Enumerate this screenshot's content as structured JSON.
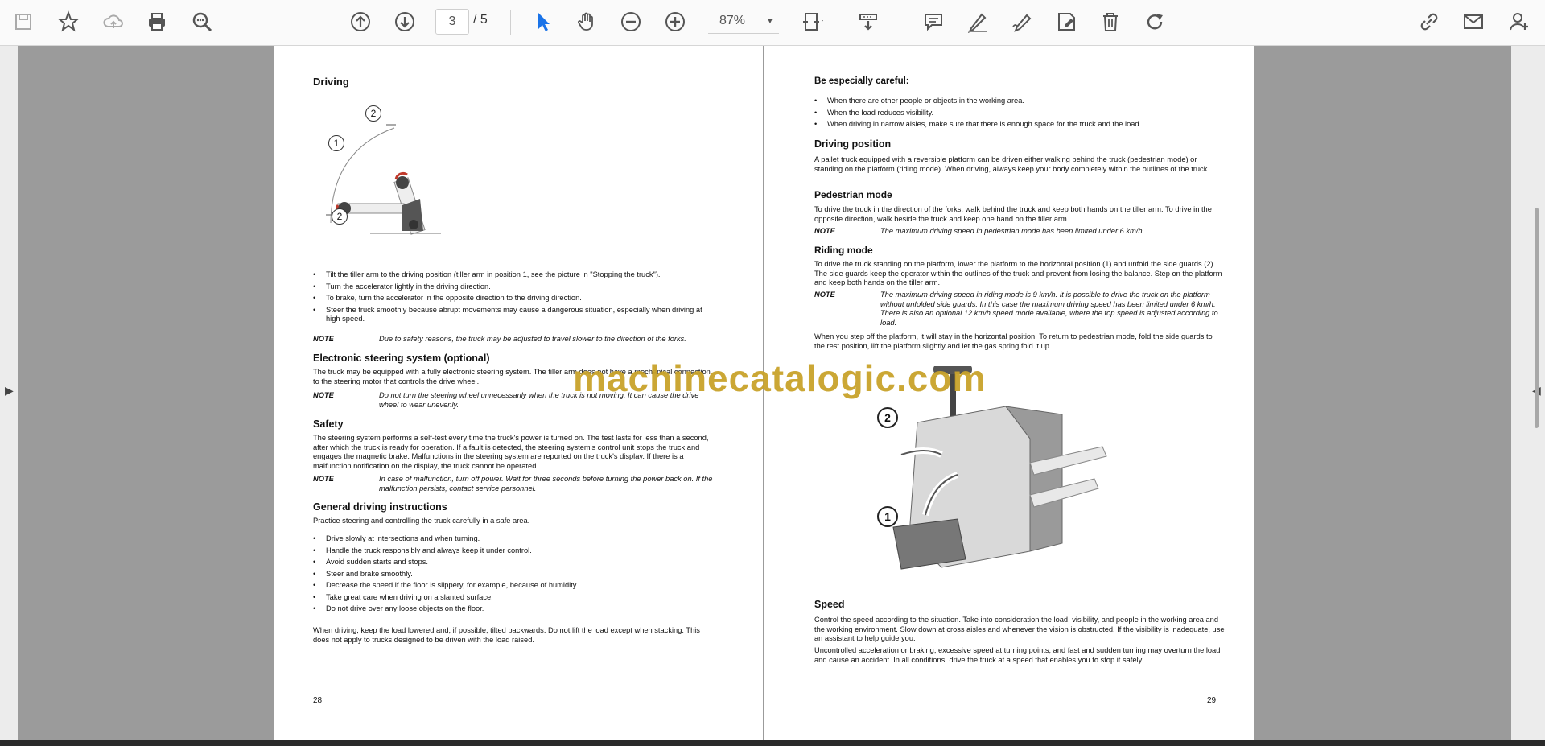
{
  "toolbar": {
    "page_current": "3",
    "page_total": "/ 5",
    "zoom": "87%"
  },
  "page_left": {
    "heading_driving": "Driving",
    "figure_labels": [
      "1",
      "2",
      "2"
    ],
    "bullets": [
      "Tilt the tiller arm to the driving position (tiller arm in position 1, see the picture in \"Stopping the truck\").",
      "Turn the accelerator lightly in the driving direction.",
      "To brake, turn the accelerator in the opposite direction to the driving direction.",
      "Steer the truck smoothly because abrupt movements may cause a dangerous situation, especially when driving at high speed."
    ],
    "note1_key": "NOTE",
    "note1_text": "Due to safety reasons, the truck may be adjusted to travel slower to the direction of the forks.",
    "heading_steering": "Electronic steering system (optional)",
    "steering_text": "The truck may be equipped with a fully electronic steering system. The tiller arm does not have a mechanical connection to the steering motor that controls the drive wheel.",
    "note2_key": "NOTE",
    "note2_text": "Do not turn the steering wheel unnecessarily when the truck is not moving. It can cause the drive wheel to wear unevenly.",
    "heading_safety": "Safety",
    "safety_text": "The steering system performs a self-test every time the truck's power is turned on. The test lasts for less than a second, after which the truck is ready for operation. If a fault is detected, the steering system's control unit stops the truck and engages the magnetic brake. Malfunctions in the steering system are reported on the truck's display. If there is a malfunction notification on the display, the truck cannot be operated.",
    "note3_key": "NOTE",
    "note3_text": "In case of malfunction, turn off power. Wait for three seconds before turning the power back on. If the malfunction persists, contact service personnel.",
    "heading_general": "General driving instructions",
    "general_text": "Practice steering and controlling the truck carefully in a safe area.",
    "general_bullets": [
      "Drive slowly at intersections and when turning.",
      "Handle the truck responsibly and always keep it under control.",
      "Avoid sudden starts and stops.",
      "Steer and brake smoothly.",
      "Decrease the speed if the floor is slippery, for example, because of humidity.",
      "Take great care when driving on a slanted surface.",
      "Do not drive over any loose objects on the floor."
    ],
    "closing_text": "When driving, keep the load lowered and, if possible, tilted backwards. Do not lift the load except when stacking. This does not apply to trucks designed to be driven with the load raised.",
    "page_number": "28"
  },
  "page_right": {
    "heading_careful": "Be especially careful:",
    "careful_bullets": [
      "When there are other people or objects in the working area.",
      "When the load reduces visibility.",
      "When driving in narrow aisles, make sure that there is enough space for the truck and the load."
    ],
    "heading_position": "Driving position",
    "position_text": "A pallet truck equipped with a reversible platform can be driven either walking behind the truck (pedestrian mode) or standing on the platform (riding mode). When driving, always keep your body completely within the outlines of the truck.",
    "heading_pedestrian": "Pedestrian mode",
    "pedestrian_text": "To drive the truck in the direction of the forks, walk behind the truck and keep both hands on the tiller arm. To drive in the opposite direction, walk beside the truck and keep one hand on the tiller arm.",
    "note1_key": "NOTE",
    "note1_text": "The maximum driving speed in pedestrian mode has been limited under 6 km/h.",
    "heading_riding": "Riding mode",
    "riding_text": "To drive the truck standing on the platform, lower the platform to the horizontal position (1) and unfold the side guards (2). The side guards keep the operator within the outlines of the truck and prevent from losing the balance. Step on the platform and keep both hands on the tiller arm.",
    "note2_key": "NOTE",
    "note2_text": "The maximum driving speed in riding mode is 9 km/h. It is possible to drive the truck on the platform without unfolded side guards. In this case the maximum driving speed has been limited under 6 km/h. There is also an optional 12 km/h speed mode available, where the top speed is adjusted according to load.",
    "step_off_text": "When you step off the platform, it will stay in the horizontal position. To return to pedestrian mode, fold the side guards to the rest position, lift the platform slightly and let the gas spring fold it up.",
    "figure_labels": [
      "2",
      "1"
    ],
    "heading_speed": "Speed",
    "speed_text1": "Control the speed according to the situation. Take into consideration the load, visibility, and people in the working area and the working environment. Slow down at cross aisles and whenever the vision is obstructed. If the visibility is inadequate, use an assistant to help guide you.",
    "speed_text2": "Uncontrolled acceleration or braking, excessive speed at turning points, and fast and sudden turning may overturn the load and cause an accident. In all conditions, drive the truck at a speed that enables you to stop it safely.",
    "page_number": "29"
  },
  "watermark": "machinecatalogic.com",
  "colors": {
    "accent_blue": "#1a73e8",
    "watermark": "#c9a32b",
    "icon_gray": "#555555"
  }
}
